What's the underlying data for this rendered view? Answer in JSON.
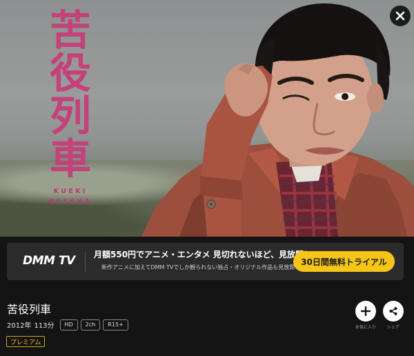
{
  "hero": {
    "title_art": [
      "苦",
      "役",
      "列",
      "車"
    ],
    "title_romanized": [
      "KUEKI",
      "RESSHA"
    ],
    "accent_color": "#c4417a"
  },
  "close_icon": "close-icon",
  "promo": {
    "logo": "DMM TV",
    "headline": "月額550円でアニメ・エンタメ 見切れないほど、見放題！",
    "subtext": "新作アニメに加えてDMM TVでしか観られない独占・オリジナル作品も見放題！",
    "cta": "30日間無料トライアル",
    "cta_color": "#f5c518"
  },
  "title": {
    "name": "苦役列車",
    "year": "2012年",
    "duration": "113分",
    "badges": [
      "HD",
      "2ch",
      "R15+"
    ],
    "tier": "プレミアム",
    "tier_color": "#f0c21b"
  },
  "actions": {
    "favorite_label": "お気に入り",
    "favorite_icon": "plus-icon",
    "share_label": "シェア",
    "share_icon": "share-icon"
  }
}
